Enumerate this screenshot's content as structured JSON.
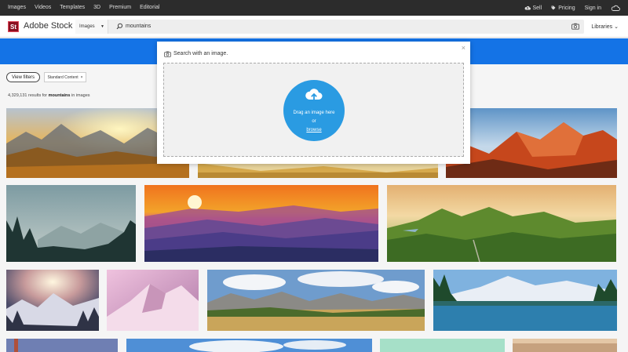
{
  "topnav": {
    "links": [
      "Images",
      "Videos",
      "Templates",
      "3D",
      "Premium",
      "Editorial"
    ],
    "sell": "Sell",
    "pricing": "Pricing",
    "sign_in": "Sign in"
  },
  "header": {
    "logo_mark": "St",
    "logo_text": "Adobe Stock",
    "search_type": "Images",
    "search_query": "mountains",
    "libraries": "Libraries"
  },
  "filters": {
    "view_filters": "View filters",
    "chip_label": "Standard Content",
    "chip_close": "×"
  },
  "results": {
    "count": "4,329,131",
    "mid": " results for ",
    "query": "mountains",
    "suffix": " in images"
  },
  "modal": {
    "title": "Search with an image.",
    "close": "×",
    "drag_text": "Drag an image here",
    "or_text": "or",
    "browse_text": "browse"
  },
  "colors": {
    "accent_blue": "#1473e6",
    "upload_circle": "#2a9be2",
    "logo_red": "#8a0e1f",
    "top_nav": "#2c2c2c"
  }
}
